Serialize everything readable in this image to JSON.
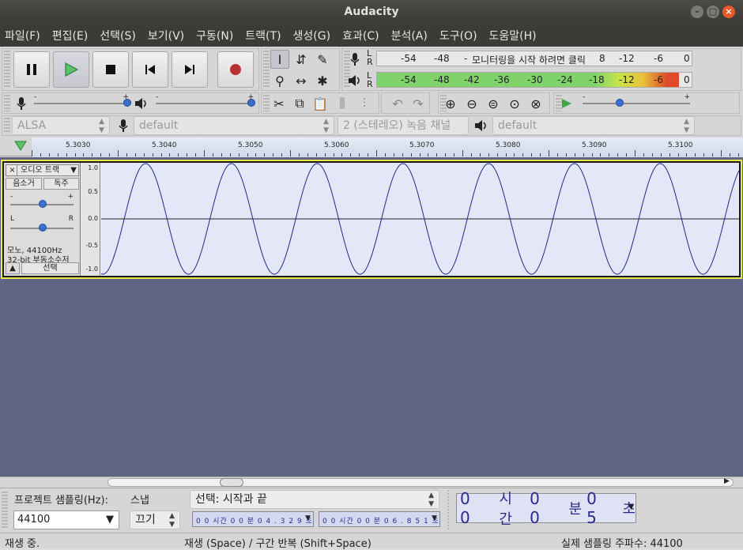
{
  "window": {
    "title": "Audacity"
  },
  "menu": [
    "파일(F)",
    "편집(E)",
    "선택(S)",
    "보기(V)",
    "구동(N)",
    "트랙(T)",
    "생성(G)",
    "효과(C)",
    "분석(A)",
    "도구(O)",
    "도움말(H)"
  ],
  "meters": {
    "record_ticks": [
      "-54",
      "-48",
      "-",
      "8",
      "-12",
      "-6",
      "0"
    ],
    "record_prompt": "모니터링을 시작 하려면 클릭",
    "play_ticks": [
      "-54",
      "-48",
      "-42",
      "-36",
      "-30",
      "-24",
      "-18",
      "-12",
      "-6",
      "0"
    ],
    "play_level": 0.96,
    "lr_top": "L",
    "lr_bottom": "R"
  },
  "gain": {
    "minus": "-",
    "plus": "+"
  },
  "device": {
    "host": "ALSA",
    "record_device": "default",
    "channels": "2 (스테레오) 녹음 채널",
    "play_device": "default"
  },
  "ruler": {
    "labels": [
      "5.3030",
      "5.3040",
      "5.3050",
      "5.3060",
      "5.3070",
      "5.3080",
      "5.3090",
      "5.3100"
    ]
  },
  "track": {
    "name": "오디오 트랙",
    "mute": "음소거",
    "solo": "독주",
    "gain_minus": "-",
    "gain_plus": "+",
    "pan_left": "L",
    "pan_right": "R",
    "info1": "모노, 44100Hz",
    "info2": "32-bit 부동소수저",
    "select": "선택",
    "amp_labels": [
      "1.0",
      "0.5",
      "0.0",
      "-0.5",
      "-1.0"
    ]
  },
  "selection": {
    "rate_label": "프로젝트 샘플링(Hz):",
    "rate_value": "44100",
    "snap_label": "스냅",
    "snap_value": "끄기",
    "mode": "선택: 시작과 끝",
    "start": "0 0 시간 0 0 분 0 4 . 3 2 9 초",
    "end": "0 0 시간 0 0 분 0 6 . 8 5 1 초",
    "time_h": "0 0",
    "time_h_unit": "시간",
    "time_m": "0 0",
    "time_m_unit": "분",
    "time_s": "0 5",
    "time_s_unit": "초"
  },
  "status": {
    "state": "재생 중.",
    "hint": "재생 (Space) / 구간 반복 (Shift+Space)",
    "rate": "실제 샘플링 주파수: 44100"
  },
  "colors": {
    "record": "#b8312f",
    "play": "#3aa84a",
    "wave": "#1e2a8c"
  }
}
